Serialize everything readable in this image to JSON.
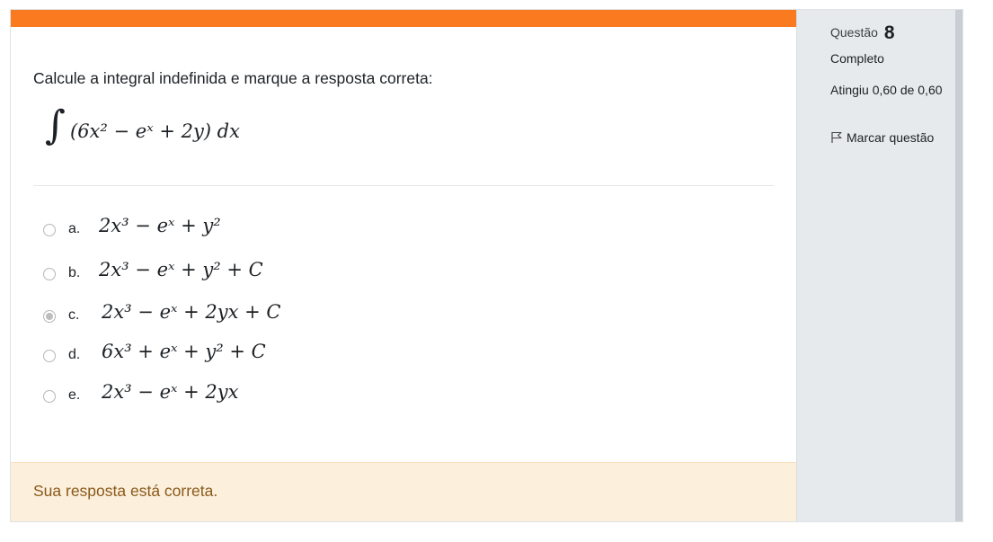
{
  "question": {
    "prompt": "Calcule a integral indefinida e marque a resposta correta:",
    "integral_sign": "∫",
    "integrand": "(6x² − eˣ + 2y) dx"
  },
  "options": [
    {
      "letter": "a.",
      "text": "2x³ − eˣ + y²",
      "selected": false
    },
    {
      "letter": "b.",
      "text": "2x³ − eˣ + y² + C",
      "selected": false
    },
    {
      "letter": "c.",
      "text": "2x³ − eˣ + 2yx + C",
      "selected": true
    },
    {
      "letter": "d.",
      "text": "6x³ + eˣ + y² + C",
      "selected": false
    },
    {
      "letter": "e.",
      "text": "2x³ − eˣ + 2yx",
      "selected": false
    }
  ],
  "feedback": "Sua resposta está correta.",
  "info": {
    "label": "Questão",
    "number": "8",
    "state": "Completo",
    "grade": "Atingiu 0,60 de 0,60",
    "flag_label": "Marcar questão",
    "flag_icon": "flag-icon"
  },
  "colors": {
    "accent": "#f97a1f",
    "feedback_bg": "#fcefdc",
    "feedback_text": "#8a5a1b",
    "info_bg": "#e7eaed"
  }
}
